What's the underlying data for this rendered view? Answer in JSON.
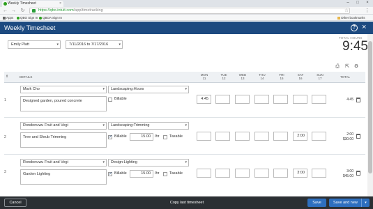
{
  "browser": {
    "tab_title": "Weekly Timesheet",
    "url_scheme": "https://",
    "url_host": "qbo.intuit.com",
    "url_path": "/app/timetracking",
    "bookmarks": [
      "Apps",
      "QBO Sign In",
      "QBOA Sign In"
    ],
    "other_bookmarks": "Other bookmarks"
  },
  "header": {
    "title": "Weekly Timesheet",
    "help": "?",
    "close": "×"
  },
  "controls": {
    "employee": "Emily Platt",
    "date_range": "7/11/2016 to 7/17/2016",
    "total_hours_label": "TOTAL HOURS",
    "total_hours": "9:45"
  },
  "table": {
    "details_header": "DETAILS",
    "days": [
      {
        "name": "MON",
        "date": "11"
      },
      {
        "name": "TUE",
        "date": "12"
      },
      {
        "name": "WED",
        "date": "13"
      },
      {
        "name": "THU",
        "date": "14"
      },
      {
        "name": "FRI",
        "date": "15"
      },
      {
        "name": "SAT",
        "date": "16"
      },
      {
        "name": "SUN",
        "date": "17"
      }
    ],
    "total_header": "TOTAL",
    "billable_label": "Billable",
    "taxable_label": "Taxable",
    "rate_unit": "/hr",
    "rows": [
      {
        "num": "1",
        "customer": "Mark Cho",
        "service": "Landscaping:Hours",
        "description": "Designed garden, poured concrete",
        "billable": false,
        "hours": [
          "4:45",
          "",
          "",
          "",
          "",
          "",
          ""
        ],
        "total": "4:45",
        "amount": ""
      },
      {
        "num": "2",
        "customer": "Rondonuwu Fruit and Vegi",
        "service": "Landscaping:Trimming",
        "description": "Tree and Shrub Trimming",
        "billable": true,
        "rate": "15.00",
        "taxable": false,
        "hours": [
          "",
          "",
          "",
          "",
          "",
          "2:00",
          ""
        ],
        "total": "2:00",
        "amount": "$30.00"
      },
      {
        "num": "3",
        "customer": "Rondonuwu Fruit and Vegi",
        "service": "Design:Lighting",
        "description": "Garden Lighting",
        "billable": true,
        "rate": "15.00",
        "taxable": false,
        "hours": [
          "",
          "",
          "",
          "",
          "",
          "3:00",
          ""
        ],
        "total": "3:00",
        "amount": "$45.00"
      }
    ]
  },
  "footer": {
    "cancel": "Cancel",
    "copy_last": "Copy last timesheet",
    "save": "Save",
    "save_and_new": "Save and new"
  }
}
